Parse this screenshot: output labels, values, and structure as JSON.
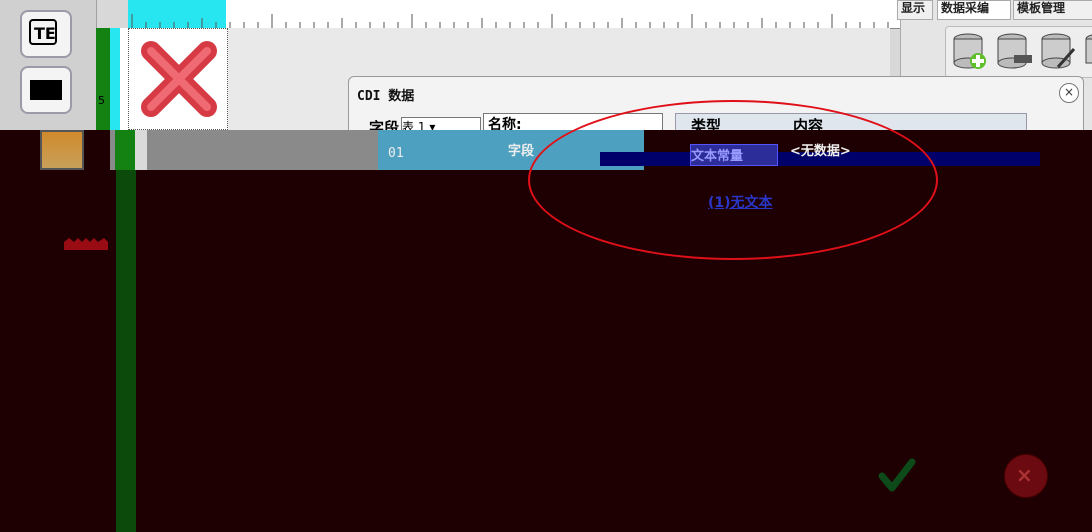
{
  "toolbar": {
    "text_tool_label": "TE",
    "rect_tool_label": ""
  },
  "ruler": {
    "left_number": "5"
  },
  "right_panel": {
    "tabs": [
      {
        "label": "显示"
      },
      {
        "label": "数据采编"
      },
      {
        "label": "模板管理"
      }
    ]
  },
  "dialog": {
    "title": "CDI 数据",
    "close_symbol": "×",
    "field_label": "字段",
    "field_select_prefix": "表",
    "field_select_value": "1",
    "name_label": "名称:",
    "col_type": "类型",
    "col_content": "内容",
    "row": {
      "id": "01",
      "field": "字段",
      "type": "文本常量",
      "content": "<无数据>"
    },
    "no_data_link": "(1)无文本"
  },
  "buttons": {
    "ok_symbol": "✓",
    "cancel_symbol": "×"
  },
  "colors": {
    "accent_cyan": "#28e6f0",
    "ruler_green": "#138213",
    "overlay": "#1e0002",
    "ellipse": "#e01018"
  }
}
